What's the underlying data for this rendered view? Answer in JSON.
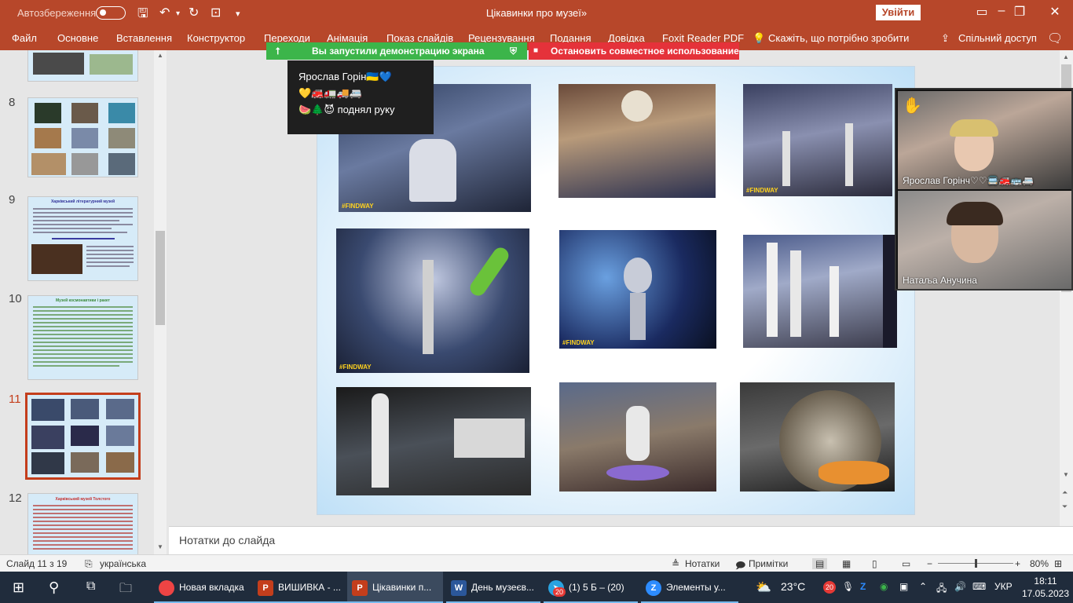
{
  "titlebar": {
    "autosave": "Автозбереження",
    "title": "Цікавинки про музеї»",
    "signin": "Увійти"
  },
  "ribbon": {
    "tabs": [
      "Файл",
      "Основне",
      "Вставлення",
      "Конструктор",
      "Переходи",
      "Анімація",
      "Показ слайдів",
      "Рецензування",
      "Подання",
      "Довідка",
      "Foxit Reader PDF",
      "Скажіть, що потрібно зробити"
    ],
    "share": "Спільний доступ"
  },
  "screenshare": {
    "sharing": "Вы запустили демонстрацию экрана",
    "stop": "Остановить совместное использование"
  },
  "notification": {
    "name": "Ярослав Горін",
    "emoji_line1": "💛🚒🚛🚚🚐",
    "emoji_line2": "🍉🌲😈",
    "action": "поднял руку"
  },
  "thumbnails": [
    {
      "num": "8"
    },
    {
      "num": "9",
      "title": "Харківський літературний музей"
    },
    {
      "num": "10",
      "title": "Музей космонавтики і ракет"
    },
    {
      "num": "11"
    },
    {
      "num": "12",
      "title": "Харківський музей Толстого"
    }
  ],
  "slide": {
    "watermark": "#FINDWAY"
  },
  "participants": [
    {
      "name": "Ярослав Горінч♡♡🚍🚒🚌🚐"
    },
    {
      "name": "Натаља Анучина"
    }
  ],
  "notes": {
    "placeholder": "Нотатки до слайда"
  },
  "status": {
    "slide": "Слайд 11 з 19",
    "language": "українська",
    "notes": "Нотатки",
    "comments": "Примітки",
    "zoom": "80%"
  },
  "taskbar": {
    "tasks": [
      "Новая вкладка",
      "ВИШИВКА - ...",
      "Цікавинки п...",
      "День музеєв...",
      "(1) 5 Б – (20)",
      "Элементы у..."
    ],
    "telegram_badge": "20",
    "weather": "23°C",
    "lang": "УКР",
    "time": "18:11",
    "date": "17.05.2023"
  }
}
